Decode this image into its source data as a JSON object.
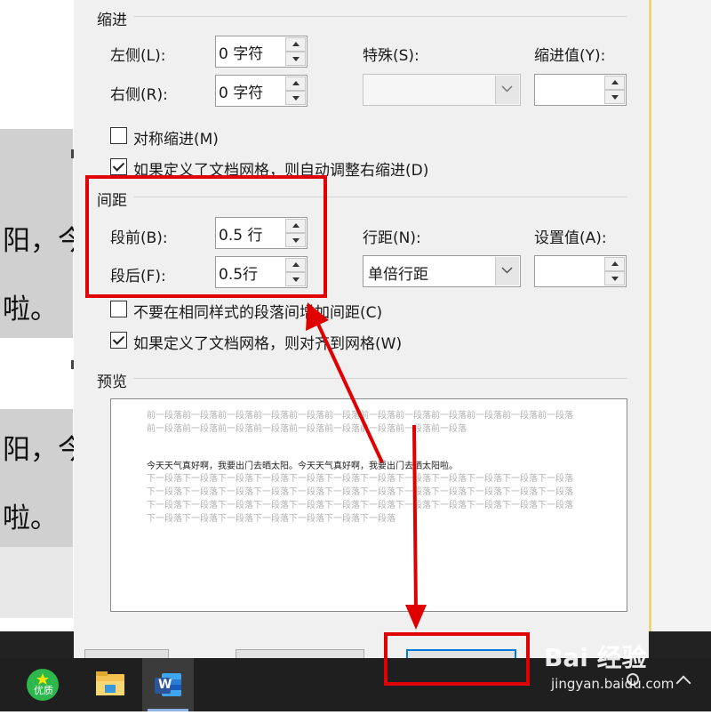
{
  "background_doc": {
    "lines": [
      "阳，今",
      "啦。",
      "阳，今",
      "啦。"
    ]
  },
  "dialog": {
    "indent": {
      "title": "缩进",
      "left_label": "左侧(L):",
      "left_value": "0 字符",
      "right_label": "右侧(R):",
      "right_value": "0 字符",
      "special_label": "特殊(S):",
      "special_value": "",
      "by_label": "缩进值(Y):",
      "by_value": "",
      "mirror_label": "对称缩进(M)",
      "mirror_checked": false,
      "auto_adjust_label": "如果定义了文档网格，则自动调整右缩进(D)",
      "auto_adjust_checked": true
    },
    "spacing": {
      "title": "间距",
      "before_label": "段前(B):",
      "before_value": "0.5 行",
      "after_label": "段后(F):",
      "after_value": "0.5行",
      "line_spacing_label": "行距(N):",
      "line_spacing_value": "单倍行距",
      "at_label": "设置值(A):",
      "at_value": "",
      "dont_add_label": "不要在相同样式的段落间增加间距(C)",
      "dont_add_checked": false,
      "snap_grid_label": "如果定义了文档网格，则对齐到网格(W)",
      "snap_grid_checked": true
    },
    "preview": {
      "title": "预览",
      "prev_text": "前一段落前一段落前一段落前一段落前一段落前一段落前一段落前一段落前一段落前一段落前一段落前一段落前一段落前一段落前一段落前一段落前一段落前一段落前一段落前一段落前一段落",
      "main_text": "今天天气真好啊，我要出门去晒太阳。今天天气真好啊，我要出门去晒太阳啦。",
      "next_text": "下一段落下一段落下一段落下一段落下一段落下一段落下一段落下一段落下一段落下一段落下一段落下一段落下一段落下一段落下一段落下一段落下一段落下一段落下一段落下一段落下一段落下一段落下一段落下一段落下一段落下一段落下一段落下一段落下一段落下一段落下一段落下一段落下一段落下一段落下一段落下一段落下一段落下一段落下一段落下一段落下一段落下一段落下一段落"
    }
  },
  "taskbar": {
    "apps": [
      {
        "name": "youzhi",
        "icon_text": "优质",
        "color": "#2db84d"
      },
      {
        "name": "file-explorer",
        "color": "#f2c14e"
      },
      {
        "name": "word",
        "icon_text": "W",
        "color": "#2b579a"
      }
    ]
  },
  "watermark": {
    "brand": "Bai 经验",
    "url": "jingyan.baidu.com"
  },
  "colors": {
    "annotation_red": "#e00000",
    "default_button_border": "#0078d7"
  }
}
